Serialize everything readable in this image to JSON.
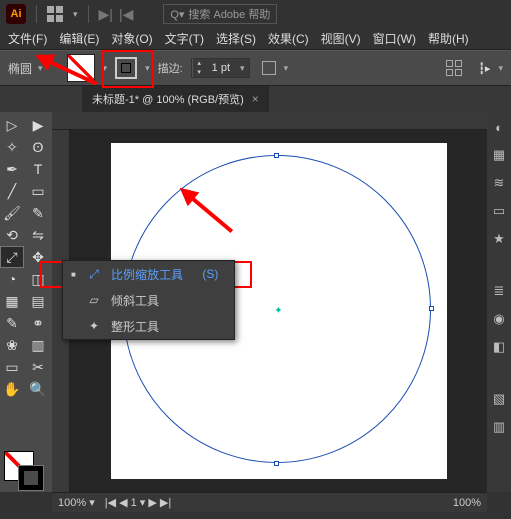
{
  "titlebar": {
    "search_placeholder": "搜索 Adobe 帮助"
  },
  "menus": [
    "文件(F)",
    "编辑(E)",
    "对象(O)",
    "文字(T)",
    "选择(S)",
    "效果(C)",
    "视图(V)",
    "窗口(W)",
    "帮助(H)"
  ],
  "ctrl": {
    "shape": "椭圆",
    "stroke_label": "描边:",
    "stroke_val": "1 pt"
  },
  "doc": {
    "tab_title": "未标题-1* @ 100% (RGB/预览)"
  },
  "flyout": {
    "items": [
      {
        "label": "比例缩放工具",
        "key": "(S)",
        "selected": true
      },
      {
        "label": "倾斜工具",
        "key": "",
        "selected": false
      },
      {
        "label": "整形工具",
        "key": "",
        "selected": false
      }
    ]
  },
  "status": {
    "zoom": "100%",
    "artboard": "1",
    "zoom2": "100%"
  }
}
